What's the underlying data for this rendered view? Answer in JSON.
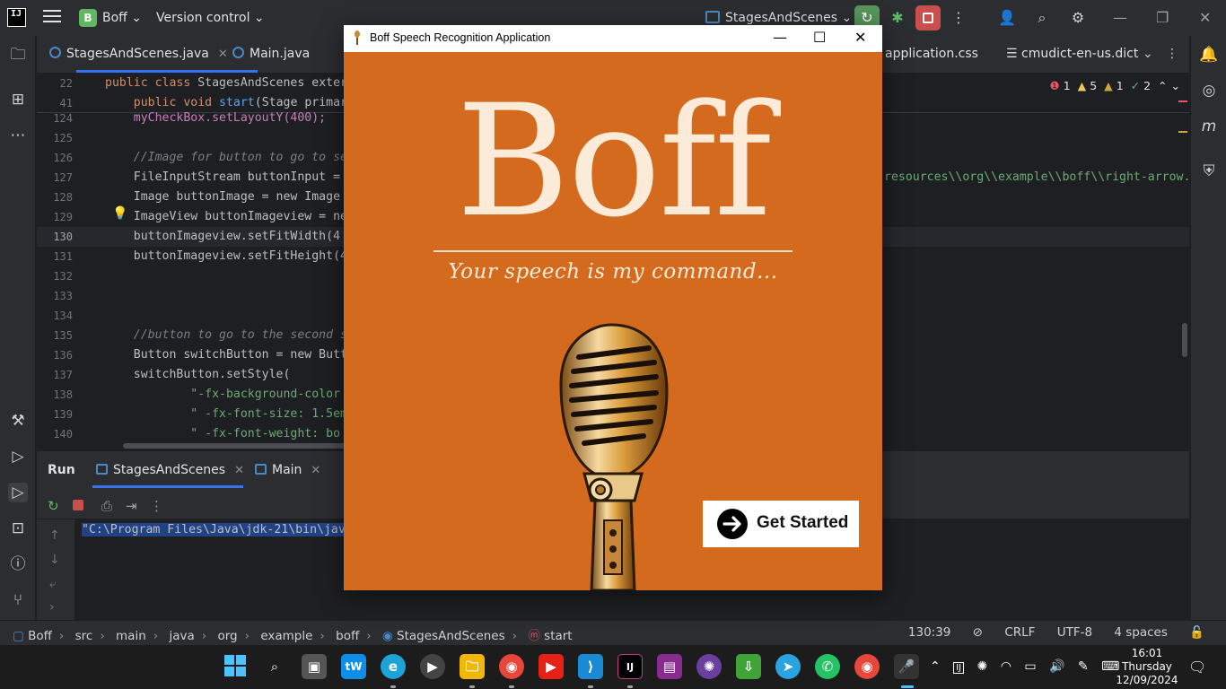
{
  "ide": {
    "logo": "IJ",
    "project_badge": "B",
    "project_name": "Boff",
    "version_control": "Version control",
    "run_config": "StagesAndScenes",
    "tabs": [
      {
        "label": "StagesAndScenes.java"
      },
      {
        "label": "Main.java"
      },
      {
        "label": "application.css"
      },
      {
        "label": "cmudict-en-us.dict"
      }
    ],
    "inspections": {
      "errors": "1",
      "warnings": "5",
      "weak": "1",
      "typos": "2"
    },
    "sticky_lines": [
      {
        "num": "22",
        "code": "public class StagesAndScenes exter"
      },
      {
        "num": "41",
        "code": "    public void start(Stage primar"
      }
    ],
    "lines": [
      {
        "num": "124",
        "code": "    myCheckBox.setLayoutY(400);"
      },
      {
        "num": "125",
        "code": ""
      },
      {
        "num": "126",
        "code": "    //Image for button to go to se"
      },
      {
        "num": "127",
        "code": "    FileInputStream buttonInput ="
      },
      {
        "num": "128",
        "code": "    Image buttonImage = new Image"
      },
      {
        "num": "129",
        "code": "    ImageView buttonImageview = ne"
      },
      {
        "num": "130",
        "code": "    buttonImageview.setFitWidth(4"
      },
      {
        "num": "131",
        "code": "    buttonImageview.setFitHeight(4"
      },
      {
        "num": "132",
        "code": ""
      },
      {
        "num": "133",
        "code": ""
      },
      {
        "num": "134",
        "code": ""
      },
      {
        "num": "135",
        "code": "    //button to go to the second s"
      },
      {
        "num": "136",
        "code": "    Button switchButton = new Butt"
      },
      {
        "num": "137",
        "code": "    switchButton.setStyle("
      },
      {
        "num": "138",
        "code": "            \"-fx-background-color"
      },
      {
        "num": "139",
        "code": "            \" -fx-font-size: 1.5em"
      },
      {
        "num": "140",
        "code": "            \" -fx-font-weight: bo"
      }
    ],
    "right_code": "resources\\\\org\\\\example\\\\boff\\\\right-arrow.",
    "run_panel": {
      "title": "Run",
      "tabs": [
        "StagesAndScenes",
        "Main"
      ],
      "console_line": "\"C:\\Program Files\\Java\\jdk-21\\bin\\jav"
    },
    "breadcrumbs": [
      "Boff",
      "src",
      "main",
      "java",
      "org",
      "example",
      "boff",
      "StagesAndScenes",
      "start"
    ],
    "status": {
      "position": "130:39",
      "line_sep": "CRLF",
      "encoding": "UTF-8",
      "indent": "4 spaces"
    }
  },
  "app_window": {
    "title": "Boff Speech Recognition Application",
    "logo_text": "Boff",
    "tagline": "Your speech is my command...",
    "button_label": "Get Started",
    "colors": {
      "background": "#d46a1e",
      "text": "#fbebd8",
      "button": "#ffffff"
    }
  },
  "taskbar": {
    "apps": [
      "start-icon",
      "search-icon",
      "task-view-icon",
      "teamviewer-icon",
      "edge-icon",
      "media-player-icon",
      "file-explorer-icon",
      "chrome-icon",
      "youtube-icon",
      "vscode-icon",
      "intellij-icon",
      "winrar-icon",
      "brain-app-icon",
      "download-manager-icon",
      "telegram-icon",
      "whatsapp-icon",
      "chrome-icon",
      "java-app-icon"
    ],
    "tray_badge": "IJ",
    "time": "16:01",
    "day": "Thursday",
    "date": "12/09/2024"
  }
}
